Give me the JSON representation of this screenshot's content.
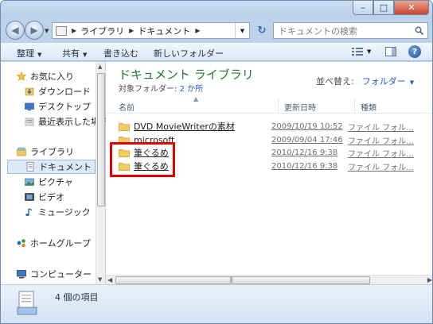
{
  "window": {
    "controls": {
      "minimize": "–",
      "maximize": "□",
      "close": "✕"
    }
  },
  "address_bar": {
    "crumbs": [
      "ライブラリ",
      "ドキュメント"
    ],
    "search_placeholder": "ドキュメントの検索"
  },
  "toolbar": {
    "organize": "整理",
    "share": "共有",
    "burn": "書き込む",
    "new_folder": "新しいフォルダー"
  },
  "nav_pane": {
    "items": [
      {
        "label": "お気に入り",
        "icon": "star-icon"
      },
      {
        "label": "ダウンロード",
        "icon": "download-folder-icon"
      },
      {
        "label": "デスクトップ",
        "icon": "desktop-icon"
      },
      {
        "label": "最近表示した場所",
        "icon": "recent-places-icon"
      },
      {
        "label": "ライブラリ",
        "icon": "libraries-icon"
      },
      {
        "label": "ドキュメント",
        "icon": "documents-icon",
        "selected": true
      },
      {
        "label": "ピクチャ",
        "icon": "pictures-icon"
      },
      {
        "label": "ビデオ",
        "icon": "videos-icon"
      },
      {
        "label": "ミュージック",
        "icon": "music-icon"
      },
      {
        "label": "ホームグループ",
        "icon": "homegroup-icon"
      },
      {
        "label": "コンピューター",
        "icon": "computer-icon"
      }
    ]
  },
  "library": {
    "title": "ドキュメント ライブラリ",
    "subtitle_prefix": "対象フォルダー:",
    "subtitle_link": "2 か所",
    "arrange_label": "並べ替え:",
    "arrange_value": "フォルダー"
  },
  "columns": {
    "name": "名前",
    "date": "更新日時",
    "type": "種類"
  },
  "files": [
    {
      "name": "DVD MovieWriterの素材",
      "date": "2009/10/19 10:52",
      "type": "ファイル フォル..."
    },
    {
      "name": "microsoft",
      "date": "2009/09/04 17:46",
      "type": "ファイル フォル..."
    },
    {
      "name": "筆ぐるめ",
      "date": "2010/12/16 9:38",
      "type": "ファイル フォル..."
    },
    {
      "name": "筆ぐるめ",
      "date": "2010/12/16 9:38",
      "type": "ファイル フォル..."
    }
  ],
  "status": {
    "item_count": "4 個の項目"
  },
  "colors": {
    "highlight": "#e00000",
    "library_title": "#1e7b28",
    "link": "#1e5bc4"
  }
}
